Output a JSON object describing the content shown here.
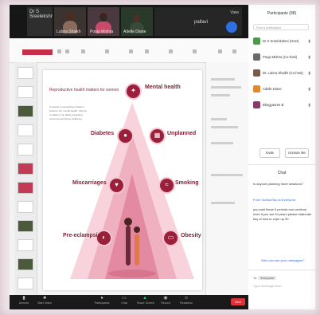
{
  "colors": {
    "accent": "#9b1f3a",
    "toolbar": "#1a1a1a",
    "end": "#e0323a"
  },
  "videos": [
    {
      "name": "Dr S Sreelekshmi...",
      "type": "text"
    },
    {
      "name": "Lubna Shaikh",
      "type": "video"
    },
    {
      "name": "Pooja Mishra",
      "type": "video"
    },
    {
      "name": "Adelle Diane",
      "type": "video"
    },
    {
      "name": "pallavi",
      "type": "text"
    }
  ],
  "gallery_label": "View",
  "slide": {
    "title": "Reproductive health matters for women",
    "intro": "A woman's reproductive health is linked to her overall health. Chronic conditions can affect pregnancy outcomes and future wellbeing.",
    "labels": {
      "mental": "Mental health",
      "diabetes": "Diabetes",
      "unplanned": "Unplanned",
      "miscarriages": "Miscarriages",
      "smoking": "Smoking",
      "preeclampsia": "Pre-eclampsia",
      "obesity": "Obesity"
    }
  },
  "toolbar": {
    "items": [
      "Unmute",
      "Start Video",
      "Participants",
      "Chat",
      "Share Screen",
      "Record",
      "Reactions"
    ],
    "end": "End"
  },
  "panel": {
    "title": "Participants (88)",
    "search_placeholder": "Find a participant",
    "participants": [
      {
        "name": "Dr S Sreelekshmi (Host)",
        "color": "#4c9a4a"
      },
      {
        "name": "Pooja Mishra (Co-host)",
        "color": "#6b6b6b"
      },
      {
        "name": "Dr. Lubna Shaikh (Co-host)",
        "color": "#7a5a4a"
      },
      {
        "name": "Adelle Diane",
        "color": "#e08a2c"
      },
      {
        "name": "Bhagyasree B",
        "color": "#8a3a6a"
      }
    ],
    "invite": "Invite",
    "unmute_all": "Unmute Me",
    "chat_title": "Chat",
    "messages": [
      {
        "from": "",
        "text": "Is anyone planning more sessions?"
      },
      {
        "from": "From Sudha Rao to Everyone:",
        "text": "you said these 5 periods can continue even if you are 54 years please elaborate key of how to cope up 30"
      }
    ],
    "who_can_see": "Who can see your messages?",
    "to_label": "To:",
    "to_value": "Everyone",
    "type_placeholder": "Type message here..."
  }
}
